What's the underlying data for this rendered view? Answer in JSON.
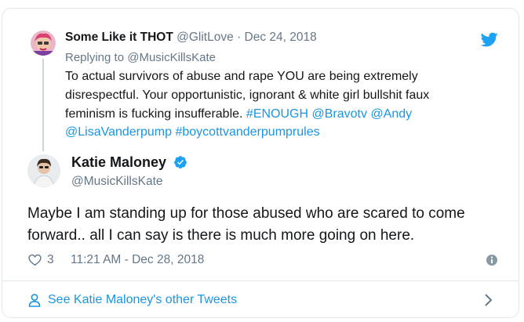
{
  "parent_tweet": {
    "display_name": "Some Like it THOT",
    "handle": "@GlitLove",
    "dot": "·",
    "date": "Dec 24, 2018",
    "replying_prefix": "Replying to",
    "replying_to": "@MusicKillsKate",
    "body_text": "To actual survivors of abuse and rape YOU are being extremely disrespectful. Your opportunistic, ignorant & white girl bullshit faux feminism is fucking insufferable.",
    "hashtags_mentions": [
      "#ENOUGH",
      "@Bravotv",
      "@Andy",
      "@LisaVanderpump",
      "#boycottvanderpumprules"
    ]
  },
  "tweet": {
    "display_name": "Katie Maloney",
    "handle": "@MusicKillsKate",
    "body": "Maybe I am standing up for those abused who are scared to come forward.. all I can say is there is much more going on here.",
    "like_count": "3",
    "timestamp": "11:21 AM - Dec 28, 2018"
  },
  "footer": {
    "label": "See Katie Maloney's other Tweets"
  },
  "colors": {
    "link": "#1b95e0",
    "muted": "#657786",
    "text": "#14171a",
    "border": "#e1e8ed"
  },
  "icons": [
    "twitter-bird-icon",
    "verified-badge-icon",
    "heart-icon",
    "info-icon",
    "person-icon",
    "chevron-right-icon"
  ]
}
